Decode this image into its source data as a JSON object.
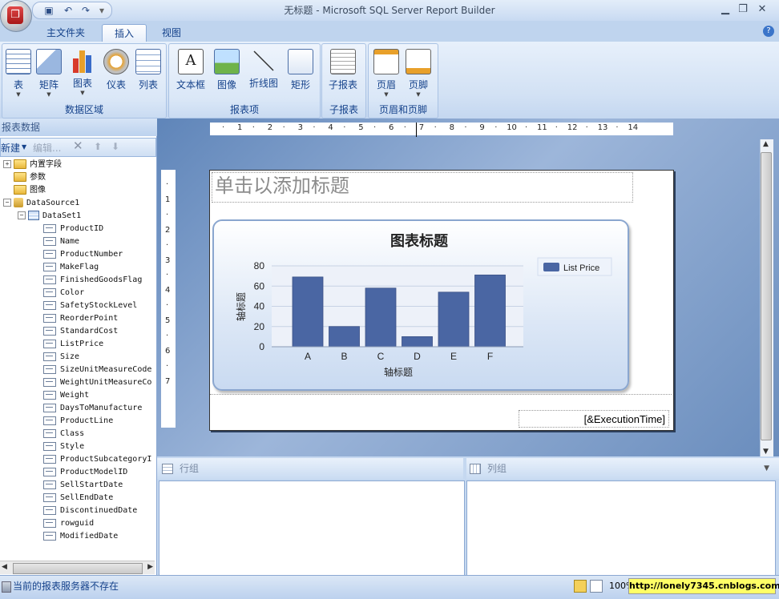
{
  "window": {
    "title": "无标题 - Microsoft SQL Server Report Builder",
    "controls": [
      "minimize-icon",
      "restore-icon",
      "close-icon"
    ]
  },
  "quick_access": [
    "save-icon",
    "undo-icon",
    "redo-icon"
  ],
  "tabs": [
    {
      "label": "主文件夹",
      "active": false
    },
    {
      "label": "插入",
      "active": true
    },
    {
      "label": "视图",
      "active": false
    }
  ],
  "ribbon": {
    "groups": [
      {
        "label": "数据区域",
        "buttons": [
          {
            "label": "表",
            "icon": "table-icon",
            "has_dropdown": true
          },
          {
            "label": "矩阵",
            "icon": "matrix-icon",
            "has_dropdown": true
          },
          {
            "label": "图表",
            "icon": "chart-icon",
            "has_dropdown": true
          },
          {
            "label": "仪表",
            "icon": "gauge-icon",
            "has_dropdown": false
          },
          {
            "label": "列表",
            "icon": "list-icon",
            "has_dropdown": false
          }
        ]
      },
      {
        "label": "报表项",
        "buttons": [
          {
            "label": "文本框",
            "icon": "textbox-icon"
          },
          {
            "label": "图像",
            "icon": "image-icon"
          },
          {
            "label": "折线图",
            "icon": "line-icon"
          },
          {
            "label": "矩形",
            "icon": "rectangle-icon"
          }
        ]
      },
      {
        "label": "子报表",
        "buttons": [
          {
            "label": "子报表",
            "icon": "subreport-icon"
          }
        ]
      },
      {
        "label": "页眉和页脚",
        "buttons": [
          {
            "label": "页眉",
            "icon": "header-icon",
            "has_dropdown": true
          },
          {
            "label": "页脚",
            "icon": "footer-icon",
            "has_dropdown": true
          }
        ]
      }
    ]
  },
  "left_panel": {
    "title": "报表数据",
    "toolbar": {
      "new": "新建",
      "edit": "编辑..."
    },
    "tree": {
      "folders": [
        "内置字段",
        "参数",
        "图像"
      ],
      "datasource": "DataSource1",
      "dataset": "DataSet1",
      "fields": [
        "ProductID",
        "Name",
        "ProductNumber",
        "MakeFlag",
        "FinishedGoodsFlag",
        "Color",
        "SafetyStockLevel",
        "ReorderPoint",
        "StandardCost",
        "ListPrice",
        "Size",
        "SizeUnitMeasureCode",
        "WeightUnitMeasureCo",
        "Weight",
        "DaysToManufacture",
        "ProductLine",
        "Class",
        "Style",
        "ProductSubcategoryI",
        "ProductModelID",
        "SellStartDate",
        "SellEndDate",
        "DiscontinuedDate",
        "rowguid",
        "ModifiedDate"
      ]
    }
  },
  "ruler": {
    "horizontal": [
      "1",
      "2",
      "3",
      "4",
      "5",
      "6",
      "7",
      "8",
      "9",
      "10",
      "11",
      "12",
      "13",
      "14"
    ],
    "vertical": [
      "1",
      "2",
      "3",
      "4",
      "5",
      "6",
      "7"
    ]
  },
  "report": {
    "title_placeholder": "单击以添加标题",
    "footer_expression": "[&ExecutionTime]"
  },
  "chart_data": {
    "type": "bar",
    "title": "图表标题",
    "xlabel": "轴标题",
    "ylabel": "轴标题",
    "categories": [
      "A",
      "B",
      "C",
      "D",
      "E",
      "F"
    ],
    "series": [
      {
        "name": "List Price",
        "values": [
          69,
          20,
          58,
          10,
          54,
          71
        ],
        "color": "#4a66a3"
      }
    ],
    "ylim": [
      0,
      80
    ],
    "yticks": [
      "0",
      "20",
      "40",
      "60",
      "80"
    ],
    "legend_position": "top-right",
    "grid": true
  },
  "grouping": {
    "rows_label": "行组",
    "columns_label": "列组"
  },
  "status": {
    "text": "当前的报表服务器不存在",
    "zoom": "100%",
    "watermark": "http://lonely7345.cnblogs.com/"
  }
}
